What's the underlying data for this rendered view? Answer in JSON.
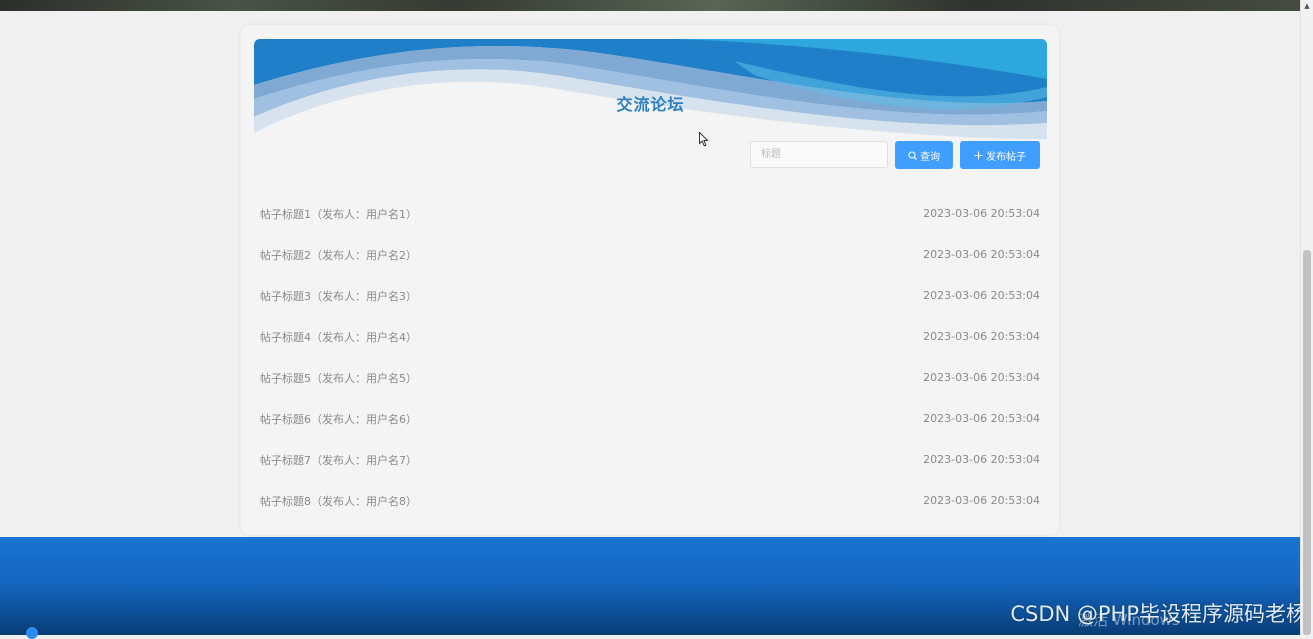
{
  "forum": {
    "title": "交流论坛",
    "search_placeholder": "标题",
    "search_button_label": "查询",
    "post_button_label": "发布帖子"
  },
  "posts": [
    {
      "title": "帖子标题1（发布人：用户名1）",
      "time": "2023-03-06 20:53:04"
    },
    {
      "title": "帖子标题2（发布人：用户名2）",
      "time": "2023-03-06 20:53:04"
    },
    {
      "title": "帖子标题3（发布人：用户名3）",
      "time": "2023-03-06 20:53:04"
    },
    {
      "title": "帖子标题4（发布人：用户名4）",
      "time": "2023-03-06 20:53:04"
    },
    {
      "title": "帖子标题5（发布人：用户名5）",
      "time": "2023-03-06 20:53:04"
    },
    {
      "title": "帖子标题6（发布人：用户名6）",
      "time": "2023-03-06 20:53:04"
    },
    {
      "title": "帖子标题7（发布人：用户名7）",
      "time": "2023-03-06 20:53:04"
    },
    {
      "title": "帖子标题8（发布人：用户名8）",
      "time": "2023-03-06 20:53:04"
    }
  ],
  "watermark": {
    "text": "CSDN @PHP毕设程序源码老杨",
    "activation_text": "激活 Windows"
  },
  "icons": {
    "search": "search-icon",
    "plus": "plus-icon",
    "scroll_up": "scroll-up-arrow-icon"
  },
  "colors": {
    "accent": "#409eff",
    "title": "#2a7fc1",
    "footer": "#1468c2"
  }
}
